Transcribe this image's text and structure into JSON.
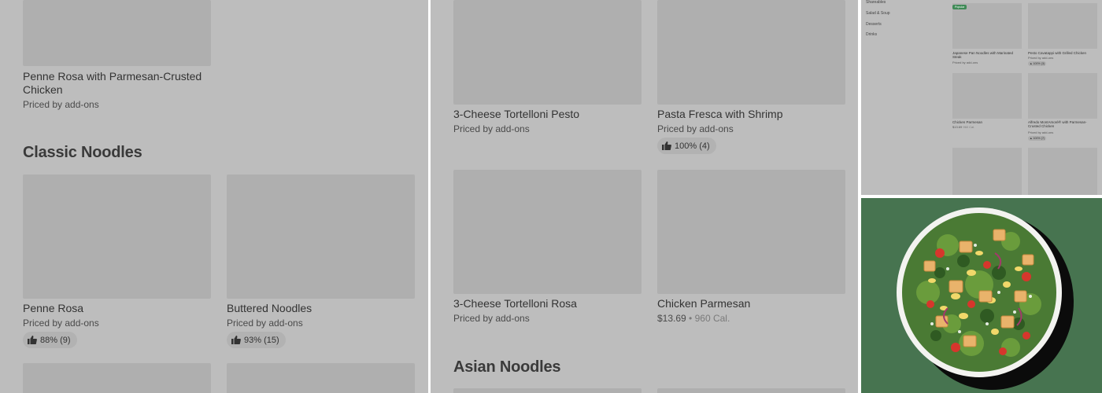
{
  "panel_a": {
    "item_top": {
      "title": "Penne Rosa with Parmesan-Crusted Chicken",
      "price": "Priced by add-ons"
    },
    "section_title": "Classic Noodles",
    "items": [
      {
        "title": "Penne Rosa",
        "price": "Priced by add-ons",
        "rating": "88% (9)"
      },
      {
        "title": "Buttered Noodles",
        "price": "Priced by add-ons",
        "rating": "93% (15)"
      }
    ]
  },
  "panel_b": {
    "items_row1": [
      {
        "title": "3-Cheese Tortelloni Pesto",
        "price": "Priced by add-ons"
      },
      {
        "title": "Pasta Fresca with Shrimp",
        "price": "Priced by add-ons",
        "rating": "100% (4)"
      }
    ],
    "items_row2": [
      {
        "title": "3-Cheese Tortelloni Rosa",
        "price": "Priced by add-ons"
      },
      {
        "title": "Chicken Parmesan",
        "price": "$13.69",
        "separator": "•",
        "calories": "960 Cal."
      }
    ],
    "section_title": "Asian Noodles"
  },
  "panel_c": {
    "nav": [
      "Shareables",
      "Salad & Soup",
      "Desserts",
      "Drinks"
    ],
    "badge": "Popular",
    "items": [
      {
        "title": "Japanese Pan Noodles with Marinated Steak",
        "price": "Priced by add-ons"
      },
      {
        "title": "Pesto Cavatappi with Grilled Chicken",
        "price": "Priced by add-ons",
        "rating": "100% (3)"
      },
      {
        "title": "Chicken Parmesan",
        "price": "$13.69",
        "calories": "960 Cal."
      },
      {
        "title": "Alfredo MontAmoré® with Parmesan-Crusted Chicken",
        "price": "Priced by add-ons",
        "rating": "100% (7)"
      }
    ]
  },
  "colors": {
    "overlay": "#bdbdbd",
    "placeholder": "#afafaf",
    "food_background": "#477450",
    "badge": "#3f8a56"
  },
  "icons": {
    "rating": "thumbs-up-icon"
  }
}
